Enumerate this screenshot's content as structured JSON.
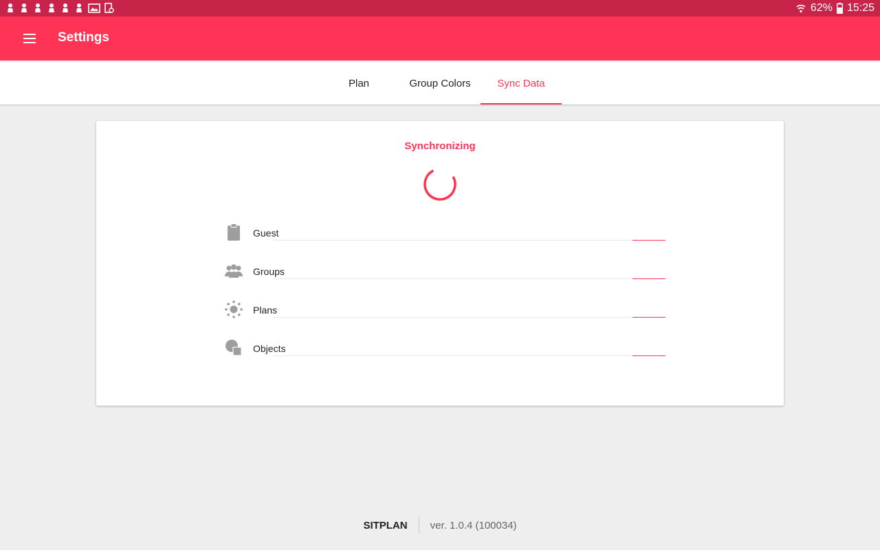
{
  "status_bar": {
    "battery": "62%",
    "time": "15:25"
  },
  "app_bar": {
    "title": "Settings"
  },
  "tabs": [
    {
      "label": "Plan"
    },
    {
      "label": "Group Colors"
    },
    {
      "label": "Sync Data"
    }
  ],
  "card": {
    "title": "Synchronizing",
    "items": [
      {
        "label": "Guest",
        "icon": "clipboard-icon",
        "progress": 0.1
      },
      {
        "label": "Groups",
        "icon": "group-icon",
        "progress": 0.1
      },
      {
        "label": "Plans",
        "icon": "sun-icon",
        "progress": 0.1
      },
      {
        "label": "Objects",
        "icon": "shapes-icon",
        "progress": 0.1
      }
    ]
  },
  "footer": {
    "brand": "SITPLAN",
    "version": "ver. 1.0.4 (100034)"
  },
  "colors": {
    "accent": "#ff3355",
    "status_bar": "#c8244a"
  }
}
